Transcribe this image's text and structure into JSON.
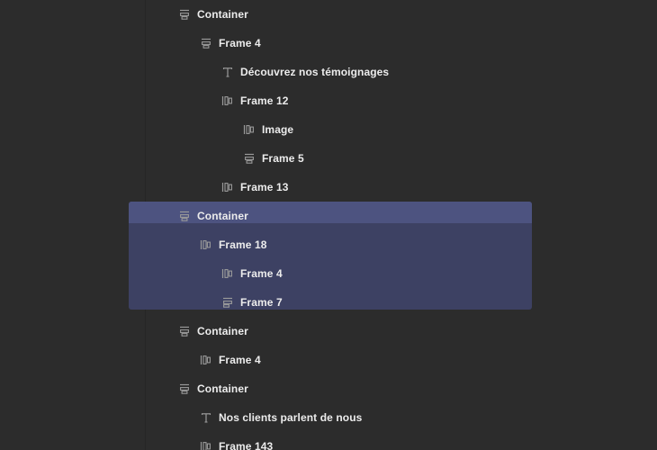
{
  "colors": {
    "background": "#2c2c2c",
    "selection": "#3d4163",
    "selection_header": "#4d5380",
    "text": "#ececec",
    "icon": "#9a9a9a"
  },
  "layers": [
    {
      "label": "Container",
      "icon": "stack-vertical-icon",
      "depth": 0,
      "selected": false
    },
    {
      "label": "Frame 4",
      "icon": "stack-vertical-icon",
      "depth": 1,
      "selected": false
    },
    {
      "label": "Découvrez nos témoignages",
      "icon": "text-icon",
      "depth": 2,
      "selected": false
    },
    {
      "label": "Frame 12",
      "icon": "stack-horizontal-icon",
      "depth": 2,
      "selected": false
    },
    {
      "label": "Image",
      "icon": "stack-horizontal-icon",
      "depth": 3,
      "selected": false
    },
    {
      "label": "Frame 5",
      "icon": "stack-vertical-icon",
      "depth": 3,
      "selected": false
    },
    {
      "label": "Frame 13",
      "icon": "stack-horizontal-icon",
      "depth": 2,
      "selected": false
    },
    {
      "label": "Container",
      "icon": "stack-vertical-icon",
      "depth": 0,
      "selected": true
    },
    {
      "label": "Frame 18",
      "icon": "stack-horizontal-icon",
      "depth": 1,
      "selected": true
    },
    {
      "label": "Frame 4",
      "icon": "stack-horizontal-icon",
      "depth": 2,
      "selected": true
    },
    {
      "label": "Frame 7",
      "icon": "stack-left-align-icon",
      "depth": 2,
      "selected": true
    },
    {
      "label": "Container",
      "icon": "stack-vertical-icon",
      "depth": 0,
      "selected": false
    },
    {
      "label": "Frame 4",
      "icon": "stack-horizontal-icon",
      "depth": 1,
      "selected": false
    },
    {
      "label": "Container",
      "icon": "stack-vertical-icon",
      "depth": 0,
      "selected": false
    },
    {
      "label": "Nos clients parlent de nous",
      "icon": "text-icon",
      "depth": 1,
      "selected": false
    },
    {
      "label": "Frame 143",
      "icon": "stack-horizontal-icon",
      "depth": 1,
      "selected": false
    }
  ]
}
